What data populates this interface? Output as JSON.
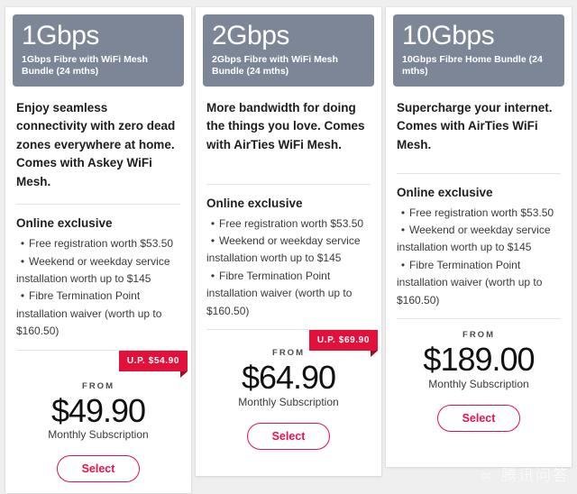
{
  "theme": {
    "page_background": "#efefef",
    "header_background": "#7d8697",
    "accent_pink": "#e8114b",
    "badge_red": "#e2113b",
    "card_background": "#ffffff",
    "divider": "#e4e4e4"
  },
  "labels": {
    "from": "FROM",
    "monthly_subscription": "Monthly Subscription",
    "promo_title": "Online exclusive",
    "select": "Select",
    "bullet_glyph": "•"
  },
  "plans": [
    {
      "speed": "1Gbps",
      "header_subtitle": "1Gbps Fibre with WiFi Mesh Bundle (24 mths)",
      "tagline": "Enjoy seamless connectivity with zero dead zones everywhere at home. Comes with Askey WiFi Mesh.",
      "promo_title": "Online exclusive",
      "promo_items": [
        "Free registration worth $53.50",
        "Weekend or weekday service installation worth up to $145",
        "Fibre Termination Point installation waiver (worth up to $160.50)"
      ],
      "up_badge": "U.P. $54.90",
      "from_label": "FROM",
      "price": "$49.90",
      "price_note": "Monthly Subscription",
      "select_label": "Select"
    },
    {
      "speed": "2Gbps",
      "header_subtitle": "2Gbps Fibre with WiFi Mesh Bundle (24 mths)",
      "tagline": "More bandwidth for doing the things you love. Comes with AirTies WiFi Mesh.",
      "promo_title": "Online exclusive",
      "promo_items": [
        "Free registration worth $53.50",
        "Weekend or weekday service installation worth up to $145",
        "Fibre Termination Point installation waiver (worth up to $160.50)"
      ],
      "up_badge": "U.P. $69.90",
      "from_label": "FROM",
      "price": "$64.90",
      "price_note": "Monthly Subscription",
      "select_label": "Select"
    },
    {
      "speed": "10Gbps",
      "header_subtitle": "10Gbps Fibre Home Bundle (24 mths)",
      "tagline": "Supercharge your internet. Comes with AirTies WiFi Mesh.",
      "promo_title": "Online exclusive",
      "promo_items": [
        "Free registration worth $53.50",
        "Weekend or weekday service installation worth up to $145",
        "Fibre Termination Point installation waiver (worth up to $160.50)"
      ],
      "up_badge": null,
      "from_label": "FROM",
      "price": "$189.00",
      "price_note": "Monthly Subscription",
      "select_label": "Select"
    }
  ],
  "watermark": "∞ 腾讯问答"
}
